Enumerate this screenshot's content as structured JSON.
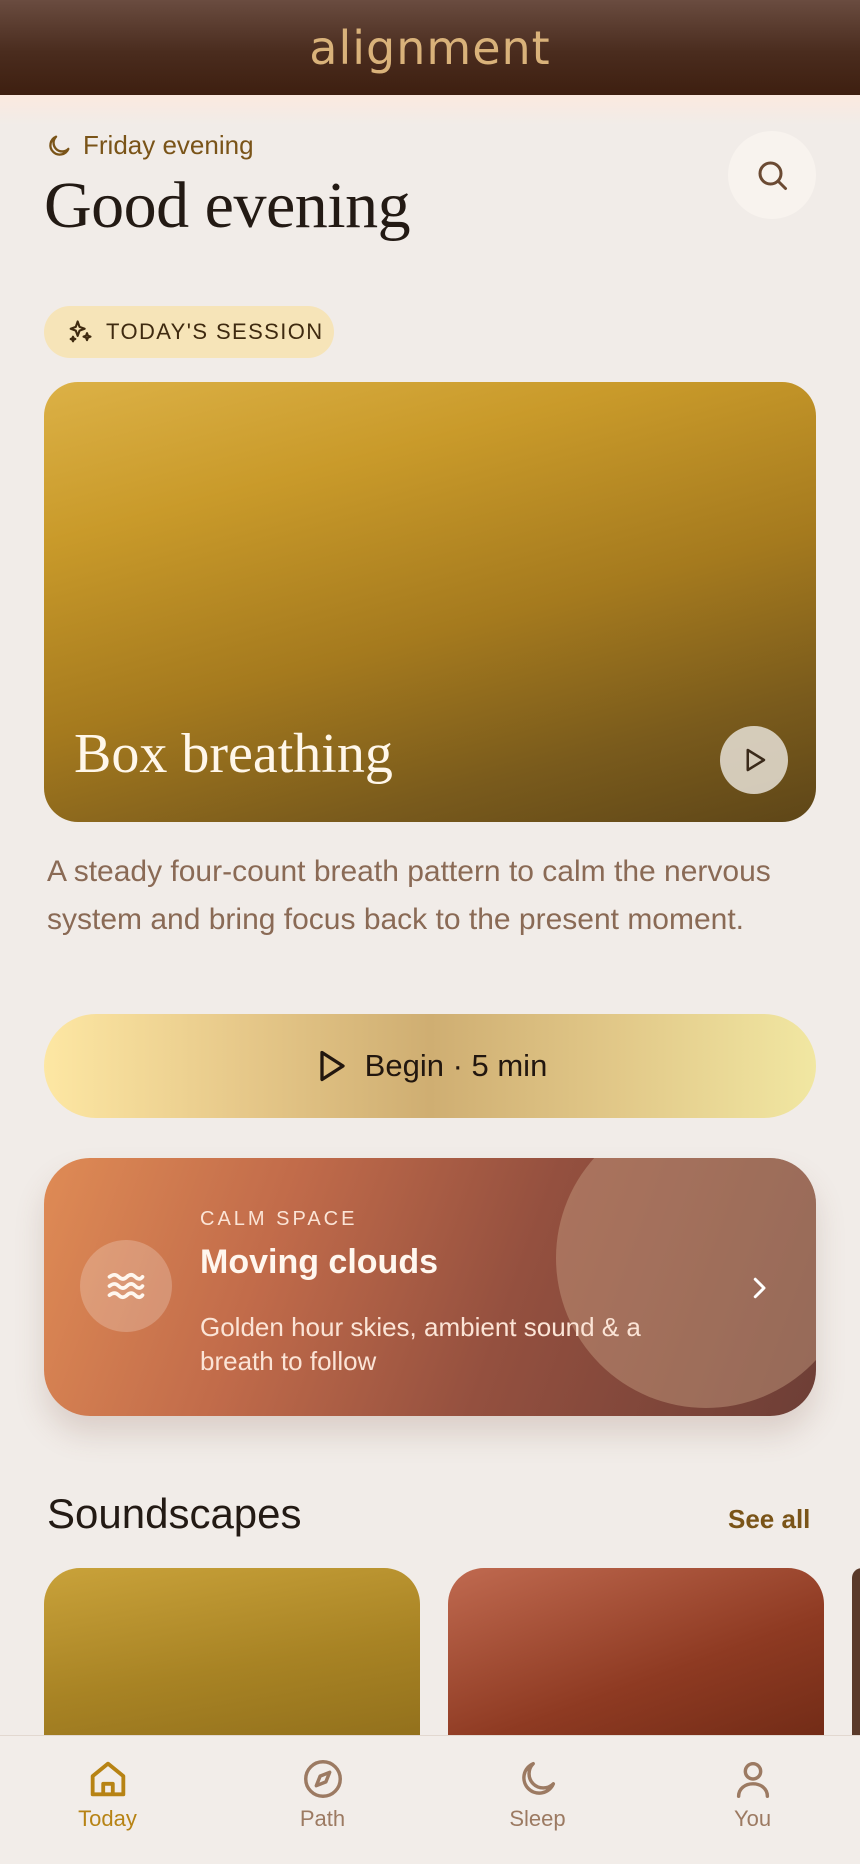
{
  "app": {
    "brand": "alignment"
  },
  "header": {
    "day_label": "Friday evening",
    "greeting": "Good evening",
    "search_icon": "search-icon"
  },
  "session": {
    "chip_label": "TODAY'S SESSION",
    "title": "Box breathing",
    "description": "A steady four-count breath pattern to calm the nervous system and bring focus back to the present moment.",
    "begin_label": "Begin · 5 min"
  },
  "calm_space": {
    "kicker": "CALM SPACE",
    "title": "Moving clouds",
    "subtitle": "Golden hour skies, ambient sound & a breath to follow"
  },
  "soundscapes": {
    "title": "Soundscapes",
    "see_all": "See all"
  },
  "tabs": [
    {
      "label": "Today",
      "icon": "home-icon",
      "active": true
    },
    {
      "label": "Path",
      "icon": "compass-icon",
      "active": false
    },
    {
      "label": "Sleep",
      "icon": "moon-icon",
      "active": false
    },
    {
      "label": "You",
      "icon": "user-icon",
      "active": false
    }
  ],
  "colors": {
    "accent": "#b78314",
    "background": "#f1ece8",
    "header": "#4a2c1e"
  }
}
